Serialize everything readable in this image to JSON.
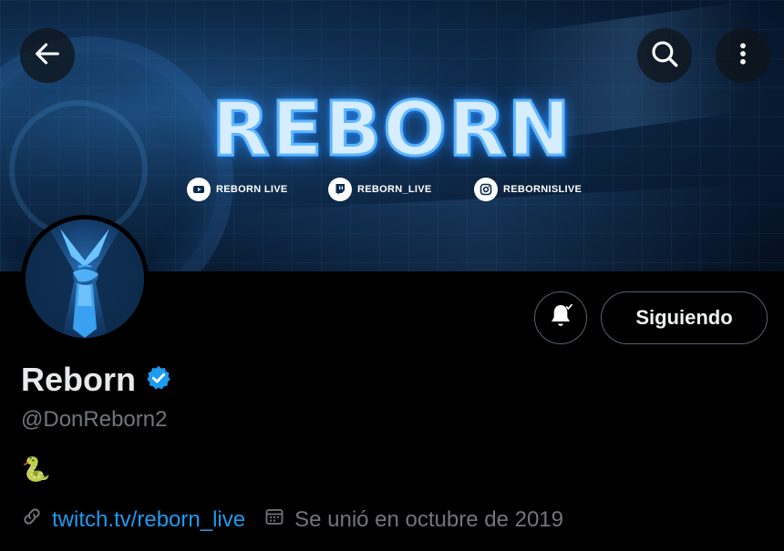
{
  "banner": {
    "brand_text": "REBORN",
    "socials": [
      {
        "icon": "youtube-icon",
        "label": "REBORN LIVE"
      },
      {
        "icon": "twitch-icon",
        "label": "REBORN_LIVE"
      },
      {
        "icon": "instagram-icon",
        "label": "REBORNISLIVE"
      }
    ]
  },
  "top_bar": {
    "back_icon": "arrow-left-icon",
    "search_icon": "search-icon",
    "more_icon": "more-vertical-icon"
  },
  "actions": {
    "notify_icon": "bell-check-icon",
    "follow_label": "Siguiendo"
  },
  "profile": {
    "display_name": "Reborn",
    "verified": true,
    "handle": "@DonReborn2",
    "bio": "🐍",
    "website": "twitch.tv/reborn_live",
    "joined": "Se unió en octubre de 2019"
  },
  "colors": {
    "background": "#000000",
    "accent": "#1d9bf0",
    "muted": "#71767b",
    "text": "#e7e9ea"
  }
}
